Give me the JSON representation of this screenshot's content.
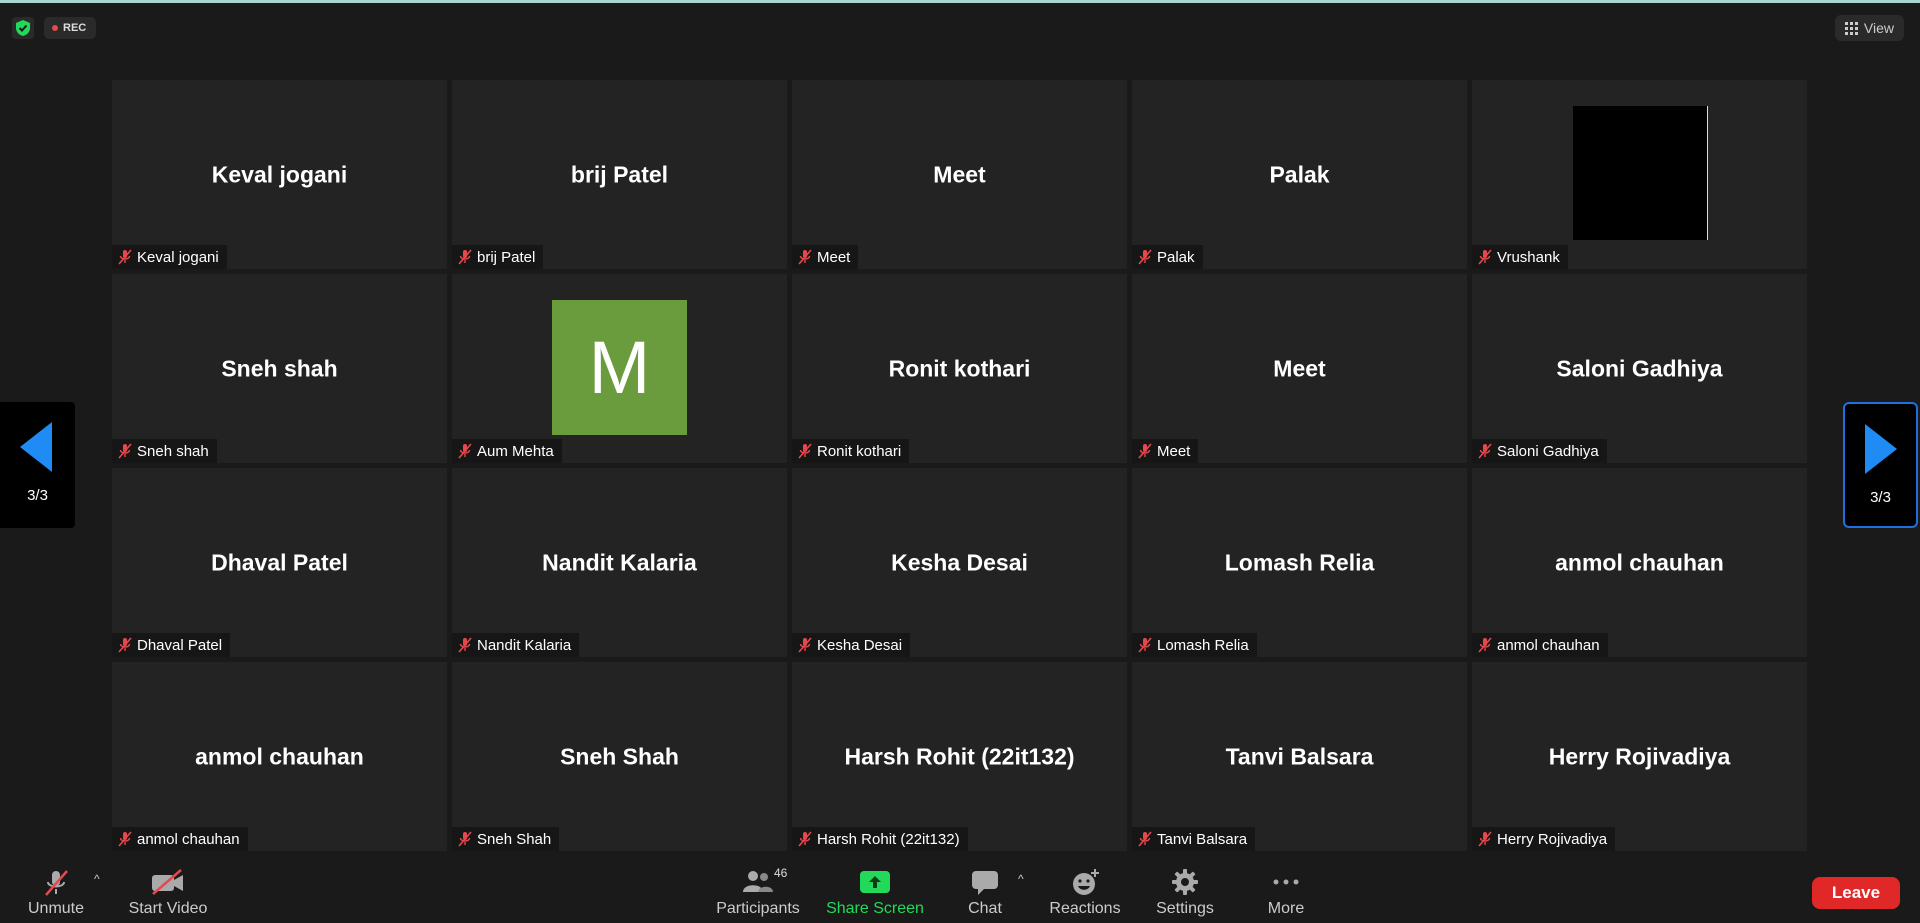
{
  "topbar": {
    "rec_label": "REC",
    "view_label": "View"
  },
  "pager": {
    "left_text": "3/3",
    "right_text": "3/3"
  },
  "tiles": [
    {
      "display": "Keval jogani",
      "label": "Keval jogani"
    },
    {
      "display": "brij Patel",
      "label": "brij Patel"
    },
    {
      "display": "Meet",
      "label": "Meet"
    },
    {
      "display": "Palak",
      "label": "Palak"
    },
    {
      "display": "",
      "label": "Vrushank"
    },
    {
      "display": "Sneh shah",
      "label": "Sneh shah"
    },
    {
      "display": "M",
      "label": "Aum Mehta"
    },
    {
      "display": "Ronit kothari",
      "label": "Ronit kothari"
    },
    {
      "display": "Meet",
      "label": "Meet"
    },
    {
      "display": "Saloni Gadhiya",
      "label": "Saloni Gadhiya"
    },
    {
      "display": "Dhaval Patel",
      "label": "Dhaval Patel"
    },
    {
      "display": "Nandit Kalaria",
      "label": "Nandit Kalaria"
    },
    {
      "display": "Kesha Desai",
      "label": "Kesha Desai"
    },
    {
      "display": "Lomash Relia",
      "label": "Lomash Relia"
    },
    {
      "display": "anmol chauhan",
      "label": "anmol chauhan"
    },
    {
      "display": "anmol chauhan",
      "label": "anmol chauhan"
    },
    {
      "display": "Sneh Shah",
      "label": "Sneh Shah"
    },
    {
      "display": "Harsh Rohit (22it132)",
      "label": "Harsh Rohit (22it132)"
    },
    {
      "display": "Tanvi Balsara",
      "label": "Tanvi Balsara"
    },
    {
      "display": "Herry Rojivadiya",
      "label": "Herry Rojivadiya"
    }
  ],
  "toolbar": {
    "unmute": "Unmute",
    "start_video": "Start Video",
    "participants": "Participants",
    "participants_count": "46",
    "share_screen": "Share Screen",
    "chat": "Chat",
    "reactions": "Reactions",
    "settings": "Settings",
    "more": "More",
    "leave": "Leave"
  },
  "colors": {
    "accent_blue": "#1f6fe0",
    "share_green": "#23d959",
    "leave_red": "#e02828",
    "avatar_green": "#6a9b3d",
    "muted_red": "#e5484d"
  },
  "icons": [
    "shield-check-icon",
    "record-dot-icon",
    "grid-view-icon",
    "mic-muted-icon",
    "video-off-icon",
    "participants-icon",
    "share-screen-icon",
    "chat-icon",
    "reactions-icon",
    "gear-icon",
    "more-icon",
    "chevron-left-icon",
    "chevron-right-icon"
  ]
}
